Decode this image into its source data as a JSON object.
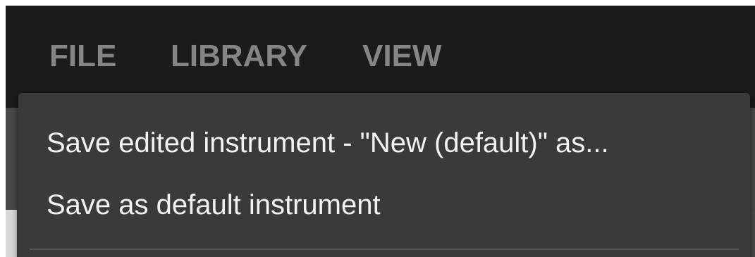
{
  "menubar": {
    "items": [
      {
        "label": "FILE"
      },
      {
        "label": "LIBRARY"
      },
      {
        "label": "VIEW"
      }
    ]
  },
  "dropdown": {
    "items": [
      {
        "label": "Save edited instrument - \"New (default)\" as..."
      },
      {
        "label": "Save as default instrument"
      }
    ]
  },
  "colors": {
    "menubar_background": "#1b1b1b",
    "menubar_text": "#858585",
    "dropdown_background": "#3a3a3a",
    "dropdown_text": "#f2f2f2"
  }
}
